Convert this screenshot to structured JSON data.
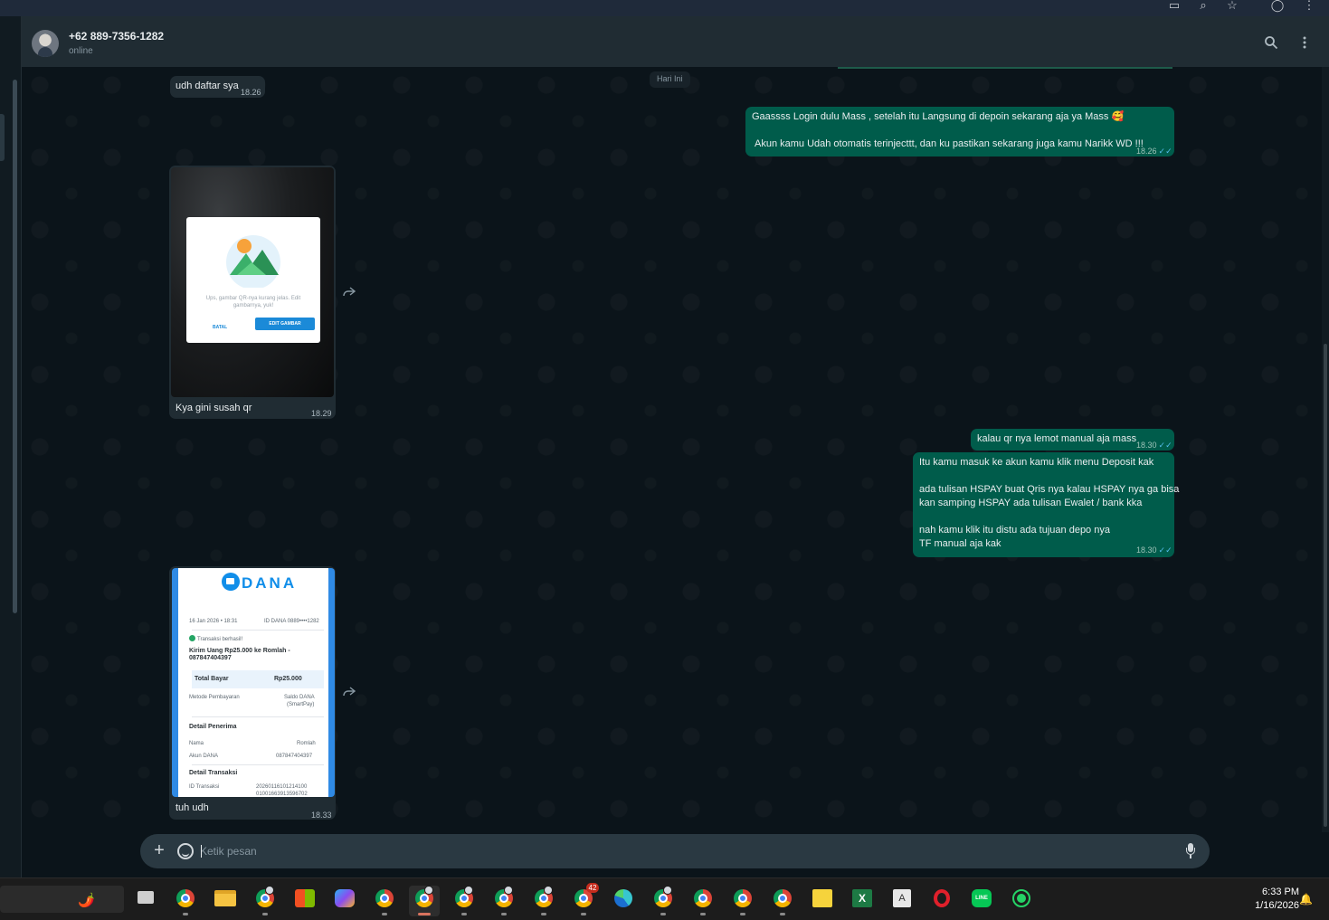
{
  "header": {
    "contact_name": "+62 889-7356-1282",
    "status": "online"
  },
  "date_chip": "Hari Ini",
  "messages": [
    {
      "dir": "in",
      "text": "udh daftar sya",
      "time": "18.26"
    },
    {
      "dir": "out",
      "lines": [
        "Gaassss Login dulu Mass  , setelah itu Langsung di depoin sekarang aja ya Mass 🥰",
        "",
        "Akun kamu Udah otomatis terinjecttt, dan ku pastikan sekarang juga kamu Narikk WD !!!"
      ],
      "time": "18.26"
    },
    {
      "dir": "in",
      "type": "image",
      "caption": "Kya gini susah qr",
      "time": "18.29",
      "image": {
        "dialog_text": "Ups, gambar QR-nya kurang jelas. Edit gambarnya, yuk!",
        "cancel": "BATAL",
        "edit": "EDIT GAMBAR"
      }
    },
    {
      "dir": "out",
      "text": "kalau qr nya lemot manual aja mass",
      "time": "18.30"
    },
    {
      "dir": "out",
      "lines": [
        "Itu kamu masuk ke akun kamu klik menu Deposit kak",
        "",
        "ada tulisan HSPAY buat Qris nya kalau HSPAY nya ga bisa",
        "kan samping HSPAY ada tulisan Ewalet / bank kka",
        "",
        "nah kamu klik itu distu ada  tujuan depo nya",
        "TF manual aja kak"
      ],
      "time": "18.30"
    },
    {
      "dir": "in",
      "type": "image",
      "caption": "tuh udh",
      "time": "18.33",
      "image": {
        "brand": "DANA",
        "date": "16 Jan 2026 • 18:31",
        "account": "ID DANA 0889••••1282",
        "status": "Transaksi berhasil!",
        "desc": "Kirim Uang Rp25.000 ke Romlah - 087847404397",
        "total_label": "Total Bayar",
        "total_value": "Rp25.000",
        "method_label": "Metode Pembayaran",
        "method_value_1": "Saldo DANA",
        "method_value_2": "(SmartPay)",
        "recipient_title": "Detail Penerima",
        "name_label": "Nama",
        "name_value": "Romlah",
        "acct_label": "Akun DANA",
        "acct_value": "087847404397",
        "tx_title": "Detail Transaksi",
        "tx_id_label": "ID Transaksi",
        "tx_id_1": "20260116101214100",
        "tx_id_2": "01001663913596702"
      }
    }
  ],
  "composer": {
    "placeholder": "Ketik pesan"
  },
  "taskbar": {
    "time": "6:33 PM",
    "date": "1/16/2026",
    "badge_count": "42",
    "apps": [
      "pepper-widget",
      "task-view",
      "chrome",
      "file-explorer",
      "chrome-profile",
      "microsoft-store",
      "copilot",
      "chrome",
      "chrome-profile",
      "chrome-profile",
      "chrome-profile",
      "chrome-profile",
      "chrome-profile",
      "edge",
      "chrome-profile",
      "chrome",
      "chrome",
      "chrome",
      "sticky-notes",
      "excel",
      "text-editor",
      "opera",
      "line",
      "whatsapp"
    ]
  },
  "colors": {
    "incoming": "#202c33",
    "outgoing": "#005c4b",
    "background": "#0b141a",
    "read_ticks": "#53bdeb"
  }
}
